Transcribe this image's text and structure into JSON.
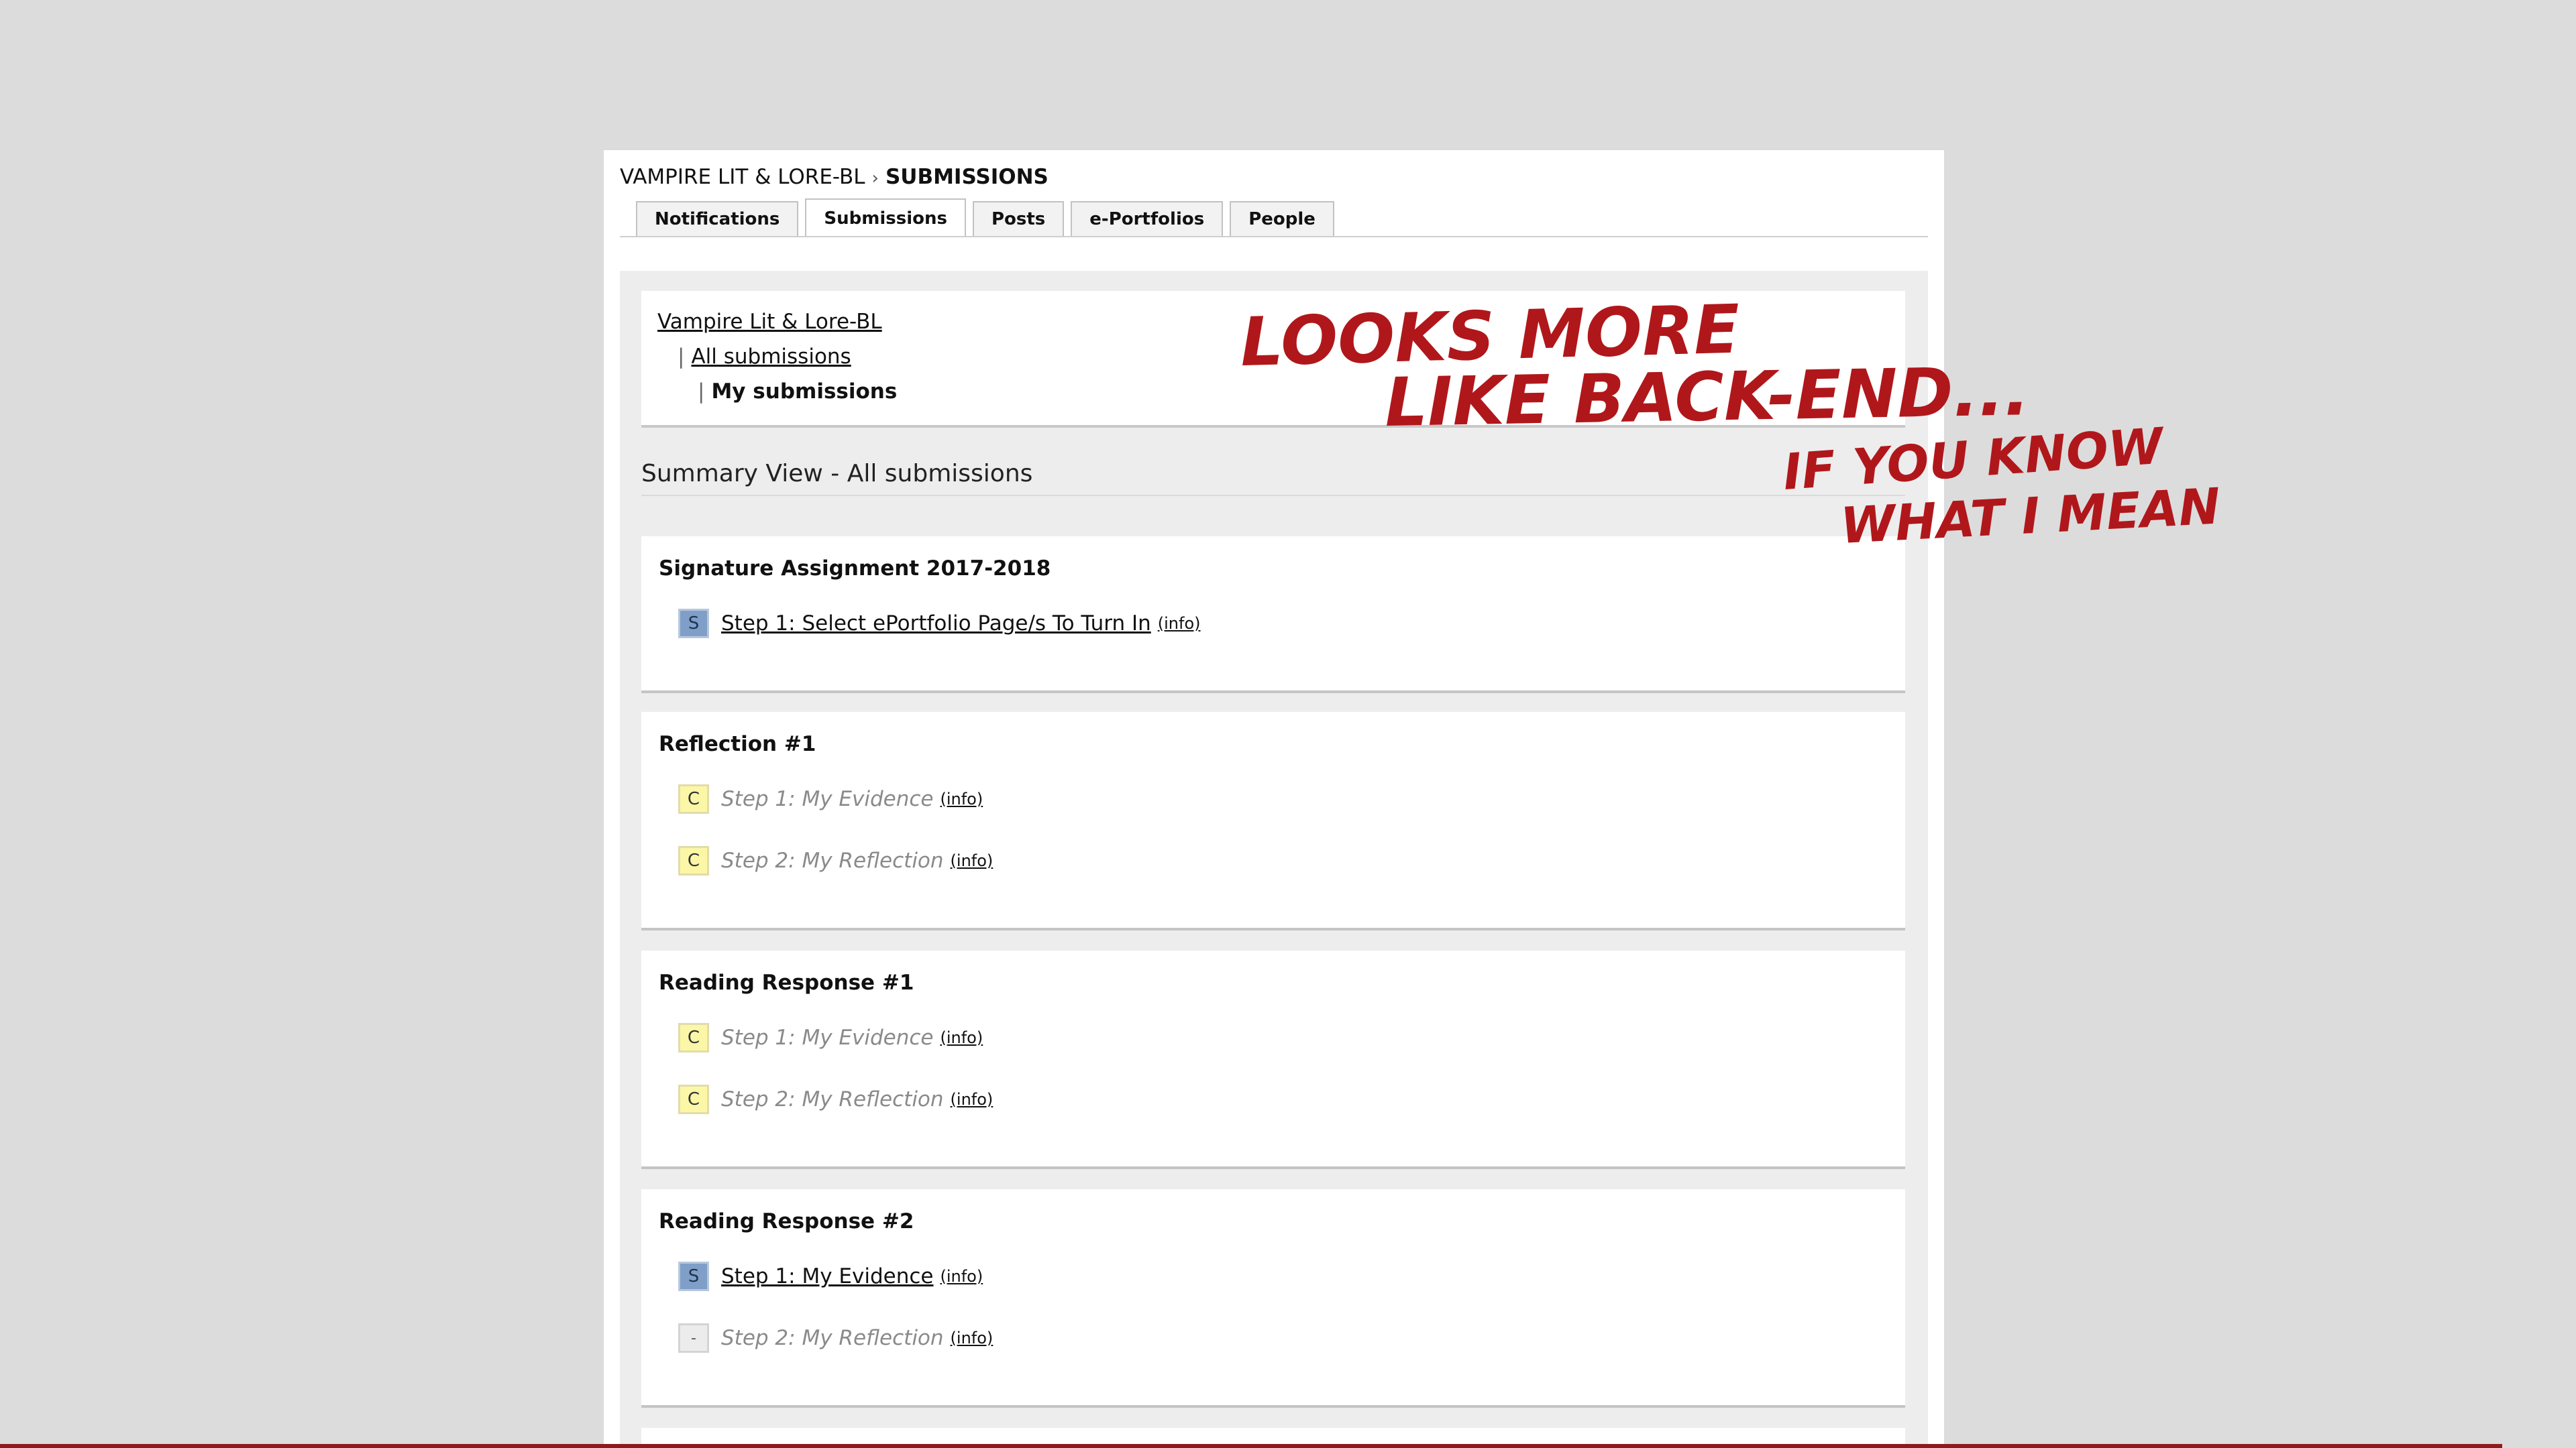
{
  "breadcrumb": {
    "course": "VAMPIRE LIT & LORE-BL",
    "separator": "›",
    "current": "SUBMISSIONS"
  },
  "tabs": [
    {
      "label": "Notifications",
      "active": false
    },
    {
      "label": "Submissions",
      "active": true
    },
    {
      "label": "Posts",
      "active": false
    },
    {
      "label": "e-Portfolios",
      "active": false
    },
    {
      "label": "People",
      "active": false
    }
  ],
  "nav": {
    "course_link": "Vampire Lit & Lore-BL",
    "bar": "|",
    "all_submissions": "All submissions",
    "my_submissions": "My submissions"
  },
  "summary": {
    "title": "Summary View - All submissions"
  },
  "status_colors": {
    "submitted": "#7f9fc9",
    "completed": "#fbf7a6",
    "not_available": "#ececec",
    "annotation": "#b0171b"
  },
  "sections": [
    {
      "title": "Signature Assignment 2017-2018",
      "steps": [
        {
          "badge": "S",
          "label": "Step 1: Select ePortfolio Page/s To Turn In",
          "info": "(info)",
          "linked": true
        }
      ]
    },
    {
      "title": "Reflection #1",
      "steps": [
        {
          "badge": "C",
          "label": "Step 1: My Evidence",
          "info": "(info)",
          "linked": false
        },
        {
          "badge": "C",
          "label": "Step 2: My Reflection",
          "info": "(info)",
          "linked": false
        }
      ]
    },
    {
      "title": "Reading Response #1",
      "steps": [
        {
          "badge": "C",
          "label": "Step 1: My Evidence",
          "info": "(info)",
          "linked": false
        },
        {
          "badge": "C",
          "label": "Step 2: My Reflection",
          "info": "(info)",
          "linked": false
        }
      ]
    },
    {
      "title": "Reading Response #2",
      "steps": [
        {
          "badge": "S",
          "label": "Step 1: My Evidence",
          "info": "(info)",
          "linked": true
        },
        {
          "badge": "-",
          "label": "Step 2: My Reflection",
          "info": "(info)",
          "linked": false
        }
      ]
    }
  ],
  "annotation": {
    "lines": [
      "LOOKS MORE",
      "LIKE BACK-END...",
      "IF YOU KNOW",
      "WHAT I MEAN"
    ]
  }
}
